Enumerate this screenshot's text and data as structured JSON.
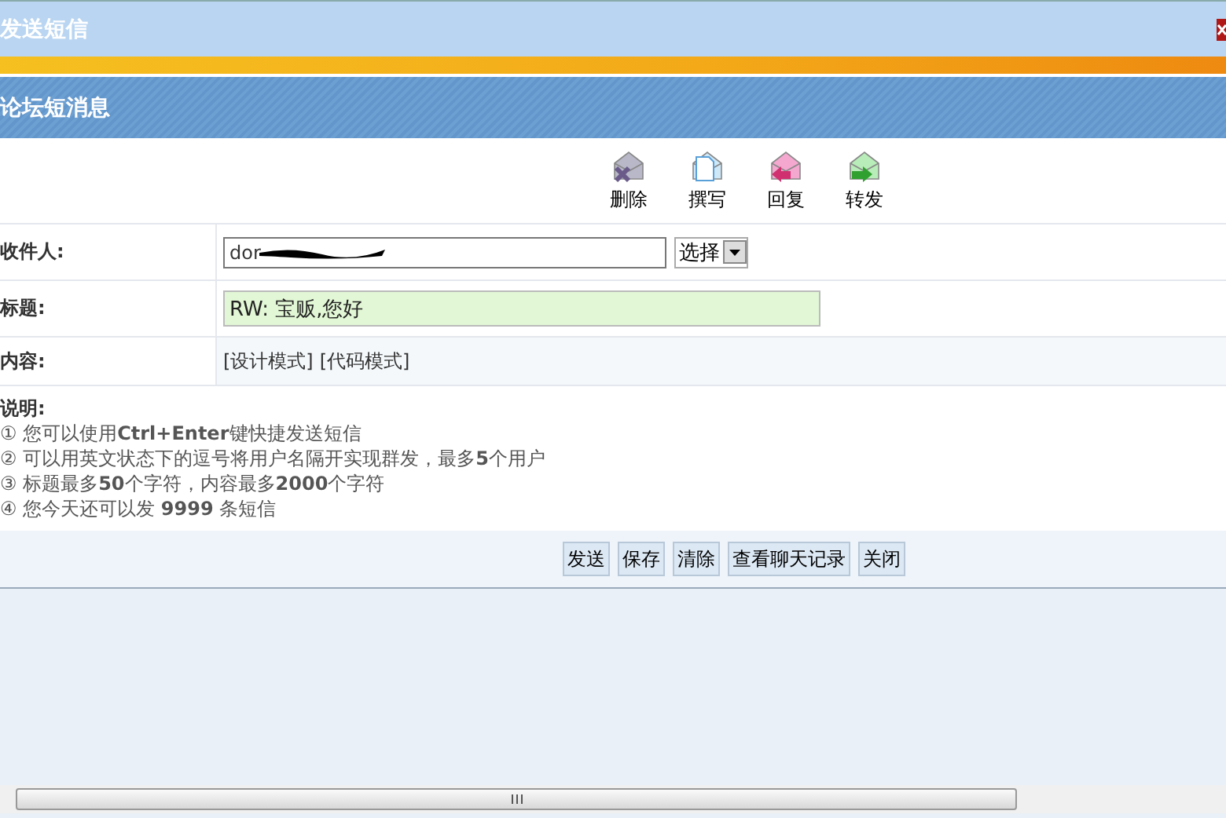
{
  "window": {
    "title": "发送短信"
  },
  "section": {
    "title": "论坛短消息"
  },
  "toolbar": [
    {
      "label": "删除",
      "kind": "delete"
    },
    {
      "label": "撰写",
      "kind": "compose"
    },
    {
      "label": "回复",
      "kind": "reply"
    },
    {
      "label": "转发",
      "kind": "forward"
    }
  ],
  "form": {
    "recipient": {
      "label": "收件人:",
      "value": "dor",
      "select": "选择"
    },
    "subject": {
      "label": "标题:",
      "value": "RW: 宝贩,您好"
    },
    "content": {
      "label": "内容:",
      "modes": [
        "[设计模式]",
        "[代码模式]"
      ]
    }
  },
  "notes": {
    "title": "说明:",
    "lines": [
      "① 您可以使用**Ctrl+Enter**键快捷发送短信",
      "② 可以用英文状态下的逗号将用户名隔开实现群发，最多**5**个用户",
      "③ 标题最多**50**个字符，内容最多**2000**个字符",
      "④ 您今天还可以发 **9999** 条短信"
    ]
  },
  "buttons": [
    "发送",
    "保存",
    "清除",
    "查看聊天记录",
    "关闭"
  ]
}
